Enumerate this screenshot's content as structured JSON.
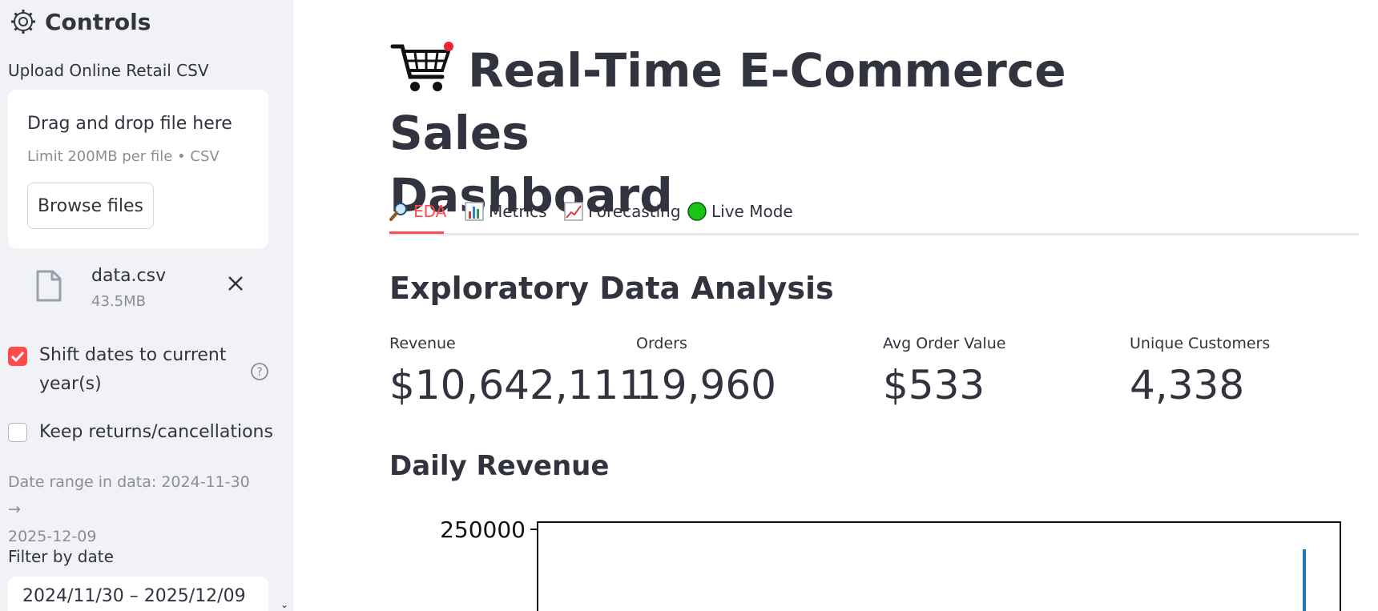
{
  "sidebar": {
    "title": "Controls",
    "upload_label": "Upload Online Retail CSV",
    "dropzone": {
      "title": "Drag and drop file here",
      "limit": "Limit 200MB per file • CSV",
      "browse_label": "Browse files"
    },
    "file": {
      "name": "data.csv",
      "size": "43.5MB"
    },
    "shift_dates": {
      "label_line1": "Shift dates to current",
      "label_line2": "year(s)",
      "checked": true
    },
    "keep_returns": {
      "label": "Keep returns/cancellations",
      "checked": false
    },
    "date_range_line1": "Date range in data: 2024-11-30 →",
    "date_range_line2": "2025-12-09",
    "filter_label": "Filter by date",
    "filter_value": "2024/11/30 – 2025/12/09"
  },
  "main": {
    "title_line1": "Real-Time E-Commerce Sales",
    "title_line2": "Dashboard",
    "tabs": [
      {
        "label": "EDA",
        "icon": "magnifier-icon",
        "active": true
      },
      {
        "label": "Metrics",
        "icon": "bar-chart-icon",
        "active": false
      },
      {
        "label": "Forecasting",
        "icon": "line-chart-icon",
        "active": false
      },
      {
        "label": "Live Mode",
        "icon": "green-circle-icon",
        "active": false
      }
    ],
    "section_title": "Exploratory Data Analysis",
    "metrics": [
      {
        "label": "Revenue",
        "value": "$10,642,111"
      },
      {
        "label": "Orders",
        "value": "19,960"
      },
      {
        "label": "Avg Order Value",
        "value": "$533"
      },
      {
        "label": "Unique Customers",
        "value": "4,338"
      }
    ],
    "chart_title": "Daily Revenue",
    "chart_data": {
      "type": "line",
      "title": "",
      "y_tick_labels": [
        "250000"
      ],
      "series": [
        {
          "color": "#1f77b4",
          "visible_spike_near_end": 230000
        }
      ]
    }
  },
  "colors": {
    "accent": "#ff4b4b",
    "sidebar_bg": "#f0f2f6",
    "text": "#31333f",
    "muted": "#8b8d97",
    "series": "#1f77b4"
  }
}
